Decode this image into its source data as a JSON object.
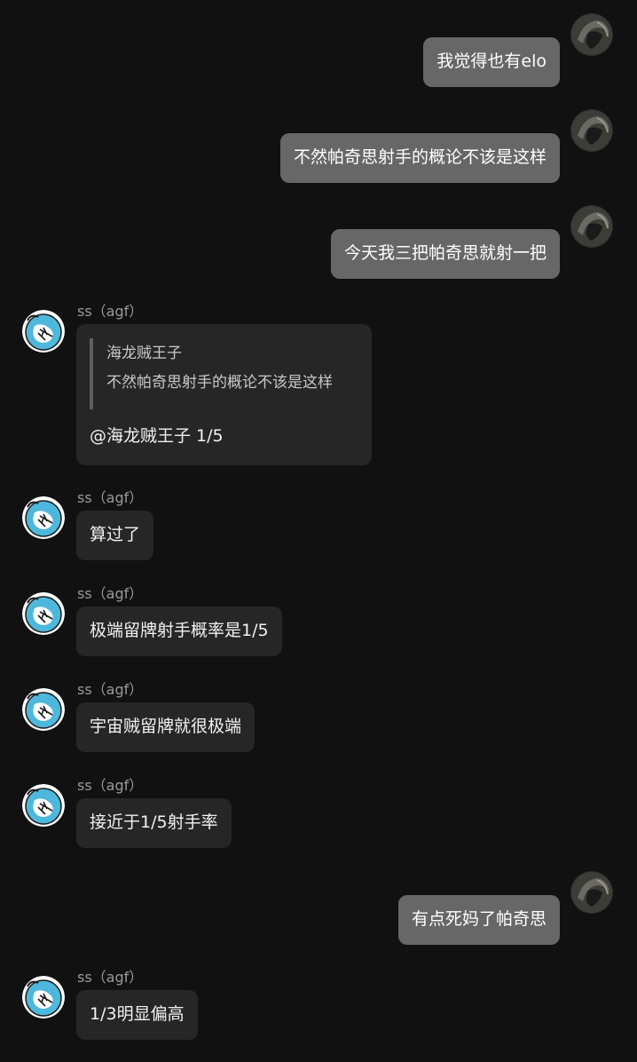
{
  "colors": {
    "background": "#111111",
    "self_bubble": "#676767",
    "other_bubble": "#262626",
    "sender_name": "#9a9a9a",
    "other_avatar": "#4db8dc"
  },
  "messages": [
    {
      "from": "self",
      "avatar_icon": "dark-helmet-avatar-icon",
      "text": "我觉得也有elo"
    },
    {
      "from": "self",
      "avatar_icon": "dark-helmet-avatar-icon",
      "text": "不然帕奇思射手的概论不该是这样"
    },
    {
      "from": "self",
      "avatar_icon": "dark-helmet-avatar-icon",
      "text": "今天我三把帕奇思就射一把"
    },
    {
      "from": "other",
      "sender": "ss（agf）",
      "avatar_icon": "blue-creature-avatar-icon",
      "quote": {
        "author": "海龙贼王子",
        "text": "不然帕奇思射手的概论不该是这样"
      },
      "text": "@海龙贼王子 1/5"
    },
    {
      "from": "other",
      "sender": "ss（agf）",
      "avatar_icon": "blue-creature-avatar-icon",
      "text": "算过了"
    },
    {
      "from": "other",
      "sender": "ss（agf）",
      "avatar_icon": "blue-creature-avatar-icon",
      "text": "极端留牌射手概率是1/5"
    },
    {
      "from": "other",
      "sender": "ss（agf）",
      "avatar_icon": "blue-creature-avatar-icon",
      "text": "宇宙贼留牌就很极端"
    },
    {
      "from": "other",
      "sender": "ss（agf）",
      "avatar_icon": "blue-creature-avatar-icon",
      "text": "接近于1/5射手率"
    },
    {
      "from": "self",
      "avatar_icon": "dark-helmet-avatar-icon",
      "text": "有点死妈了帕奇思"
    },
    {
      "from": "other",
      "sender": "ss（agf）",
      "avatar_icon": "blue-creature-avatar-icon",
      "text": "1/3明显偏高"
    }
  ]
}
